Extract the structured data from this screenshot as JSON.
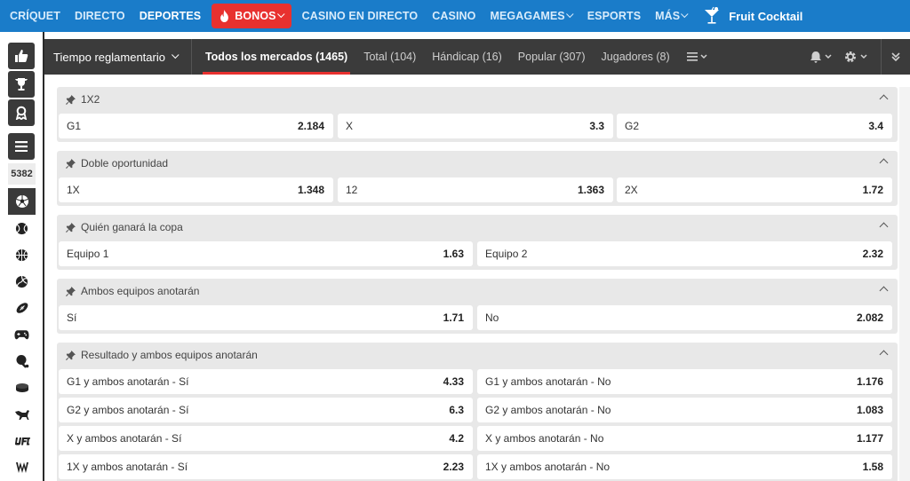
{
  "topnav": {
    "items": [
      "CRÍQUET",
      "DIRECTO",
      "DEPORTES"
    ],
    "bonos": "BONOS",
    "items2": [
      "CASINO EN DIRECTO",
      "CASINO",
      "MEGAGAMES",
      "ESPORTS",
      "MÁS"
    ],
    "game": "Fruit Cocktail"
  },
  "sidebar": {
    "count": "5382"
  },
  "header": {
    "period": "Tiempo reglamentario",
    "tabs": [
      "Todos los mercados (1465)",
      "Total (104)",
      "Hándicap (16)",
      "Popular (307)",
      "Jugadores (8)"
    ]
  },
  "markets": [
    {
      "title": "1X2",
      "odds": [
        [
          "G1",
          "2.184"
        ],
        [
          "X",
          "3.3"
        ],
        [
          "G2",
          "3.4"
        ]
      ]
    },
    {
      "title": "Doble oportunidad",
      "odds": [
        [
          "1X",
          "1.348"
        ],
        [
          "12",
          "1.363"
        ],
        [
          "2X",
          "1.72"
        ]
      ]
    },
    {
      "title": "Quién ganará la copa",
      "odds": [
        [
          "Equipo 1",
          "1.63"
        ],
        [
          "Equipo 2",
          "2.32"
        ]
      ]
    },
    {
      "title": "Ambos equipos anotarán",
      "odds": [
        [
          "Sí",
          "1.71"
        ],
        [
          "No",
          "2.082"
        ]
      ]
    },
    {
      "title": "Resultado y ambos equipos anotarán",
      "odds": [
        [
          "G1 y ambos anotarán - Sí",
          "4.33"
        ],
        [
          "G1 y ambos anotarán - No",
          "1.176"
        ],
        [
          "G2 y ambos anotarán - Sí",
          "6.3"
        ],
        [
          "G2 y ambos anotarán - No",
          "1.083"
        ],
        [
          "X y ambos anotarán - Sí",
          "4.2"
        ],
        [
          "X y ambos anotarán - No",
          "1.177"
        ],
        [
          "1X y ambos anotarán - Sí",
          "2.23"
        ],
        [
          "1X y ambos anotarán - No",
          "1.58"
        ]
      ]
    }
  ],
  "colors": {
    "topbar": "#1a7cc9",
    "bonos": "#e8312f",
    "header": "#3b3b3b",
    "market_bg": "#e8e8e8"
  }
}
